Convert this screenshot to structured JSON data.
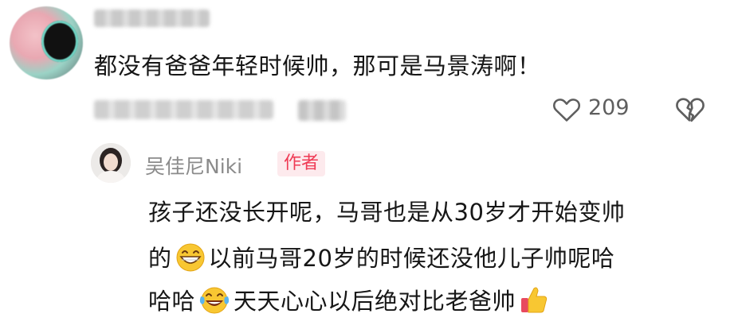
{
  "top_comment": {
    "text": "都没有爸爸年轻时候帅，那可是马景涛啊！",
    "likes": "209"
  },
  "reply": {
    "author": "吴佳尼Niki",
    "badge": "作者",
    "line1": "孩子还没长开呢，马哥也是从30岁才开始变帅",
    "line2_a": "的",
    "line2_b": "以前马哥20岁的时候还没他儿子帅呢哈",
    "line3_a": "哈哈",
    "line3_b": "天天心心以后绝对比老爸帅"
  },
  "icons": {
    "like": "heart-outline-icon",
    "dislike": "broken-heart-icon",
    "emoji_grin": "grinning-face-emoji",
    "emoji_tears": "tears-of-joy-emoji",
    "emoji_thumb": "thumbs-up-emoji"
  },
  "colors": {
    "badge_text": "#ef3b55",
    "badge_bg": "#fdeaed",
    "muted_text": "#8b8b8b",
    "count_text": "#5e5e5e"
  }
}
